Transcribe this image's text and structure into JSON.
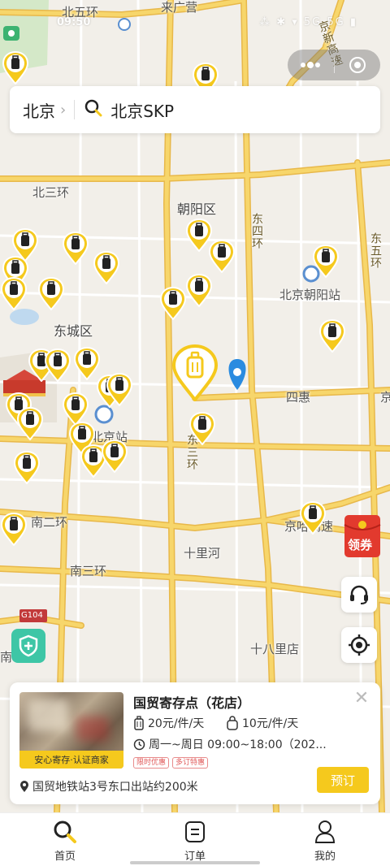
{
  "status_bar": {
    "time": "09:50",
    "right": "⁂ ✱ ▾ 5G 5G ▮"
  },
  "search": {
    "city": "北京",
    "chevron": "›",
    "query": "北京SKP",
    "search_icon": "search-icon"
  },
  "capsule": {
    "more_icon": "more-dots-icon",
    "close_icon": "target-circle-icon"
  },
  "map": {
    "labels": [
      "北五环",
      "北三环",
      "朝阳区",
      "东城区",
      "北京朝阳站",
      "四惠",
      "北京站",
      "南二环",
      "南三环",
      "十里河",
      "十八里店",
      "京哈高速",
      "G104",
      "来广营",
      "东四环",
      "东五环",
      "东三环",
      "京新高速",
      "南",
      "京东"
    ],
    "colors": {
      "base": "#f2efe9",
      "road": "#f7d66b",
      "road_edge": "#e8b84a",
      "park": "#cfe6c3",
      "pin": "#f5c91d"
    }
  },
  "side_buttons": {
    "coupon_label": "领券",
    "service_icon": "headset-icon",
    "locate_icon": "locate-icon",
    "shield_icon": "shield-plus-icon"
  },
  "store": {
    "thumb_label": "安心寄存·认证商家",
    "name": "国贸寄存点（花店）",
    "price_large": "20元/件/天",
    "price_small": "10元/件/天",
    "hours": "周一~周日 09:00~18:00（202...",
    "tags": [
      "限时优惠",
      "多订特惠"
    ],
    "address": "国贸地铁站3号东口出站约200米",
    "book_label": "预订",
    "close_label": "✕"
  },
  "tabs": [
    {
      "label": "首页",
      "icon": "search-icon"
    },
    {
      "label": "订单",
      "icon": "order-list-icon"
    },
    {
      "label": "我的",
      "icon": "user-icon"
    }
  ]
}
